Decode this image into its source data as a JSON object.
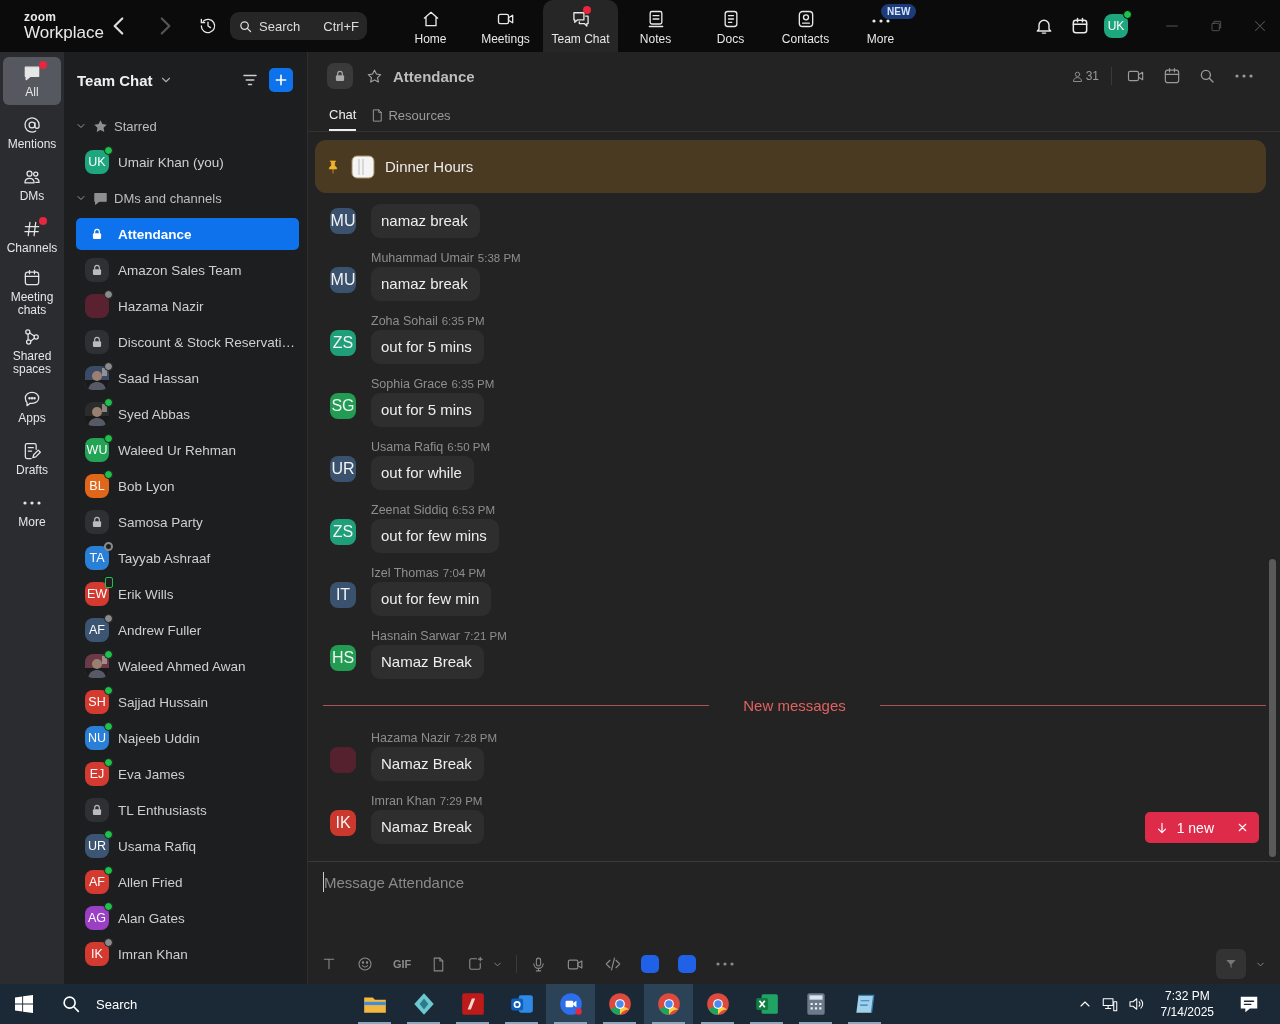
{
  "top_bar": {
    "logo_top": "zoom",
    "logo_bottom": "Workplace",
    "search": {
      "placeholder": "Search",
      "shortcut": "Ctrl+F"
    },
    "nav": [
      {
        "label": "Home",
        "kind": "home",
        "selected": false,
        "dot": false
      },
      {
        "label": "Meetings",
        "kind": "video",
        "selected": false,
        "dot": false
      },
      {
        "label": "Team Chat",
        "kind": "chat",
        "selected": true,
        "dot": true
      },
      {
        "label": "Notes",
        "kind": "notes",
        "selected": false,
        "dot": false
      },
      {
        "label": "Docs",
        "kind": "docs",
        "selected": false,
        "dot": false
      },
      {
        "label": "Contacts",
        "kind": "contacts",
        "selected": false,
        "dot": false
      },
      {
        "label": "More",
        "kind": "dots",
        "selected": false,
        "dot": false,
        "badge": "NEW"
      }
    ],
    "user": {
      "initials": "UK",
      "color": "#1ea67f",
      "status": {
        "kind": "online"
      }
    }
  },
  "rail": [
    {
      "label": "All",
      "kind": "bubble",
      "selected": true,
      "dot": true
    },
    {
      "label": "Mentions",
      "kind": "at",
      "selected": false,
      "dot": false
    },
    {
      "label": "DMs",
      "kind": "people",
      "selected": false,
      "dot": false
    },
    {
      "label": "Channels",
      "kind": "hash",
      "selected": false,
      "dot": true
    },
    {
      "label": "Meeting chats",
      "kind": "calendar",
      "selected": false,
      "dot": false
    },
    {
      "label": "Shared spaces",
      "kind": "share",
      "selected": false,
      "dot": false
    },
    {
      "label": "Apps",
      "kind": "speech",
      "selected": false,
      "dot": false
    },
    {
      "label": "Drafts",
      "kind": "draft",
      "selected": false,
      "dot": false
    },
    {
      "label": "More",
      "kind": "dots",
      "selected": false,
      "dot": false
    }
  ],
  "sidebar": {
    "title": "Team Chat",
    "sections": [
      {
        "label": "Starred",
        "kind": "star",
        "expanded": true,
        "items": [
          {
            "kind": "person",
            "name": "Umair Khan (you)",
            "initials": "UK",
            "color": "#1ea67f",
            "status": {
              "kind": "online"
            },
            "selected": false
          }
        ]
      },
      {
        "label": "DMs and channels",
        "kind": "bubble",
        "expanded": true,
        "items": [
          {
            "kind": "channel",
            "name": "Attendance",
            "selected": true
          },
          {
            "kind": "channel",
            "name": "Amazon Sales Team",
            "selected": false
          },
          {
            "kind": "person",
            "name": "Hazama Nazir",
            "color": "#5a2230",
            "status": {
              "kind": "away"
            },
            "selected": false
          },
          {
            "kind": "channel",
            "name": "Discount & Stock Reservati…",
            "selected": false
          },
          {
            "name": "Saad Hassan",
            "status": {
              "kind": "away"
            },
            "selected": false
          },
          {
            "name": "Syed Abbas",
            "status": {
              "kind": "online"
            },
            "selected": false
          },
          {
            "kind": "person",
            "name": "Waleed Ur Rehman",
            "initials": "WU",
            "color": "#22a355",
            "status": {
              "kind": "online"
            },
            "selected": false
          },
          {
            "kind": "person",
            "name": "Bob Lyon",
            "initials": "BL",
            "color": "#e0661a",
            "status": {
              "kind": "online"
            },
            "selected": false
          },
          {
            "kind": "channel",
            "name": "Samosa Party",
            "selected": false
          },
          {
            "kind": "person",
            "name": "Tayyab Ashraaf",
            "initials": "TA",
            "color": "#2a80d6",
            "status": {
              "kind": "offline"
            },
            "selected": false
          },
          {
            "kind": "person",
            "name": "Erik Wills",
            "initials": "EW",
            "color": "#d43a2f",
            "status": {
              "kind": "mobile"
            },
            "selected": false
          },
          {
            "kind": "person",
            "name": "Andrew Fuller",
            "initials": "AF",
            "color": "#3c5573",
            "status": {
              "kind": "away"
            },
            "selected": false
          },
          {
            "name": "Waleed Ahmed Awan",
            "status": {
              "kind": "online"
            },
            "selected": false
          },
          {
            "kind": "person",
            "name": "Sajjad Hussain",
            "initials": "SH",
            "color": "#d43a2f",
            "status": {
              "kind": "online"
            },
            "selected": false
          },
          {
            "kind": "person",
            "name": "Najeeb Uddin",
            "initials": "NU",
            "color": "#2a80d6",
            "status": {
              "kind": "online"
            },
            "selected": false
          },
          {
            "kind": "person",
            "name": "Eva James",
            "initials": "EJ",
            "color": "#d43a2f",
            "status": {
              "kind": "online"
            },
            "selected": false
          },
          {
            "kind": "channel",
            "name": "TL Enthusiasts",
            "selected": false
          },
          {
            "kind": "person",
            "name": "Usama Rafiq",
            "initials": "UR",
            "color": "#3c5573",
            "status": {
              "kind": "online"
            },
            "selected": false
          },
          {
            "kind": "person",
            "name": "Allen Fried",
            "initials": "AF",
            "color": "#d43a2f",
            "status": {
              "kind": "online"
            },
            "selected": false
          },
          {
            "kind": "person",
            "name": "Alan Gates",
            "initials": "AG",
            "color": "#9b3fc4",
            "status": {
              "kind": "online"
            },
            "selected": false
          },
          {
            "kind": "person",
            "name": "Imran Khan",
            "initials": "IK",
            "color": "#d43a2f",
            "status": {
              "kind": "away"
            },
            "selected": false
          }
        ]
      }
    ]
  },
  "chat": {
    "title": "Attendance",
    "starred": false,
    "members": "31",
    "tabs": [
      {
        "label": "Chat",
        "selected": true
      },
      {
        "label": "Resources",
        "selected": false
      }
    ],
    "pinned": "Dinner Hours",
    "messages": [
      {
        "kind": "message",
        "initials": "MU",
        "color": "#3c5573",
        "text": "namaz break"
      },
      {
        "kind": "message",
        "name": "Muhammad Umair",
        "time": "5:38 PM",
        "initials": "MU",
        "color": "#3c5573",
        "text": "namaz break"
      },
      {
        "kind": "message",
        "name": "Zoha Sohail",
        "time": "6:35 PM",
        "initials": "ZS",
        "color": "#1ea67f",
        "text": "out for 5 mins"
      },
      {
        "kind": "message",
        "name": "Sophia Grace",
        "time": "6:35 PM",
        "initials": "SG",
        "color": "#22a355",
        "text": "out for 5 mins"
      },
      {
        "kind": "message",
        "name": "Usama Rafiq",
        "time": "6:50 PM",
        "initials": "UR",
        "color": "#3c5573",
        "text": "out for while"
      },
      {
        "kind": "message",
        "name": "Zeenat Siddiq",
        "time": "6:53 PM",
        "initials": "ZS",
        "color": "#1ea67f",
        "text": "out for few mins"
      },
      {
        "kind": "message",
        "name": "Izel Thomas",
        "time": "7:04 PM",
        "initials": "IT",
        "color": "#3c5573",
        "text": "out for few min"
      },
      {
        "kind": "message",
        "name": "Hasnain Sarwar",
        "time": "7:21 PM",
        "initials": "HS",
        "color": "#22a355",
        "text": "Namaz Break"
      },
      {
        "kind": "divider",
        "text": "New messages"
      },
      {
        "kind": "message",
        "name": "Hazama Nazir",
        "time": "7:28 PM",
        "color": "#5a2230",
        "text": "Namaz Break"
      },
      {
        "kind": "message",
        "name": "Imran Khan",
        "time": "7:29 PM",
        "initials": "IK",
        "color": "#d43a2f",
        "text": "Namaz Break"
      }
    ],
    "jump": "1 new",
    "composer": {
      "placeholder": "Message Attendance",
      "gif": "GIF"
    }
  },
  "taskbar": {
    "search": "Search",
    "apps": [
      {
        "kind": "folder",
        "active": false
      },
      {
        "kind": "diamond",
        "active": false
      },
      {
        "kind": "ftp",
        "active": false
      },
      {
        "kind": "mail",
        "active": false
      },
      {
        "kind": "meet",
        "active": true
      },
      {
        "kind": "browser",
        "active": false
      },
      {
        "kind": "browser",
        "active": true
      },
      {
        "kind": "browser",
        "active": false
      },
      {
        "kind": "sheet",
        "active": false
      },
      {
        "kind": "calc",
        "active": false
      },
      {
        "kind": "notepad",
        "active": false
      }
    ],
    "time": "7:32 PM",
    "date": "7/14/2025"
  }
}
